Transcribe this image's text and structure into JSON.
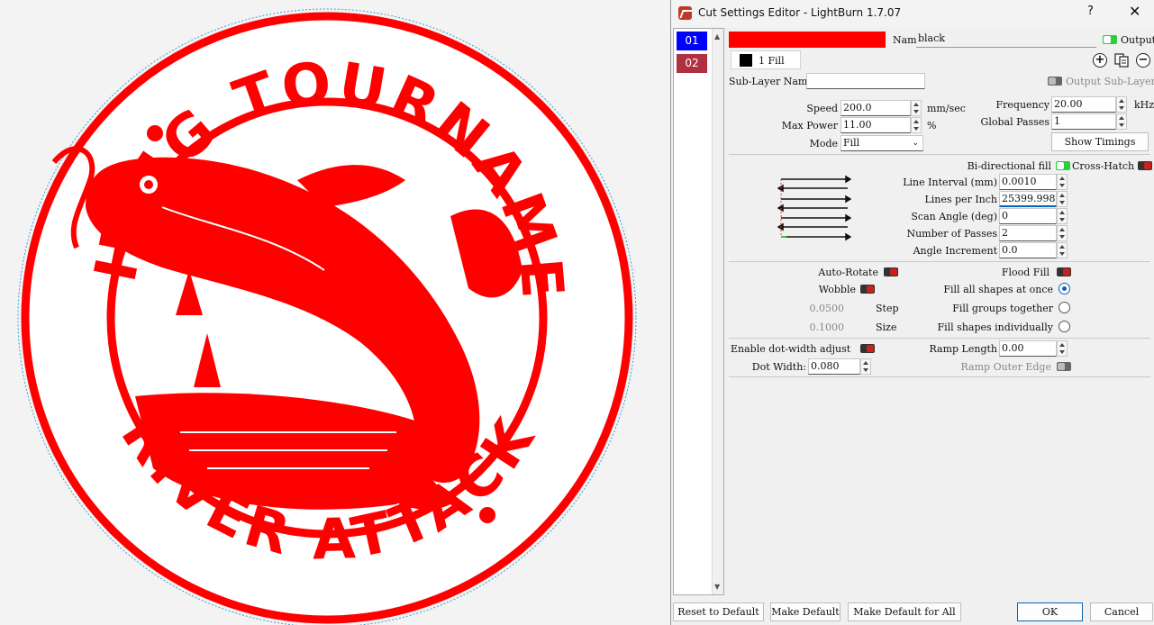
{
  "canvas": {
    "top_text": "FISHING TOURNAMENT",
    "bottom_text": "RIVER ATTACK",
    "design_color": "#ff0000"
  },
  "dialog": {
    "title": "Cut Settings Editor - LightBurn 1.7.07",
    "help": "?",
    "close": "✕",
    "layers": [
      {
        "label": "01",
        "color": "#0000ff"
      },
      {
        "label": "02",
        "color": "#b03040"
      }
    ],
    "layer_color": "#ff0000",
    "name_label": "Name",
    "name_value": "black",
    "output_label": "Output",
    "sublayer_tab": "1 Fill",
    "sublayer_name_label": "Sub-Layer Name",
    "sublayer_name_value": "",
    "output_sublayer_label": "Output Sub-Layer",
    "speed": {
      "label": "Speed",
      "value": "200.0",
      "unit": "mm/sec"
    },
    "max_power": {
      "label": "Max Power",
      "value": "11.00",
      "unit": "%"
    },
    "mode": {
      "label": "Mode",
      "value": "Fill"
    },
    "frequency": {
      "label": "Frequency",
      "value": "20.00",
      "unit": "kHz"
    },
    "global_passes": {
      "label": "Global Passes",
      "value": "1"
    },
    "show_timings": "Show Timings",
    "bidir_label": "Bi-directional fill",
    "crosshatch_label": "Cross-Hatch",
    "line_interval": {
      "label": "Line Interval (mm)",
      "value": "0.0010"
    },
    "lines_per_inch": {
      "label": "Lines per Inch",
      "value": "25399.998"
    },
    "scan_angle": {
      "label": "Scan Angle (deg)",
      "value": "0"
    },
    "num_passes": {
      "label": "Number of Passes",
      "value": "2"
    },
    "angle_increment": {
      "label": "Angle Increment",
      "value": "0.0"
    },
    "auto_rotate": "Auto-Rotate",
    "flood_fill": "Flood Fill",
    "wobble": "Wobble",
    "step": {
      "label": "Step",
      "value": "0.0500"
    },
    "size": {
      "label": "Size",
      "value": "0.1000"
    },
    "fill_all": "Fill all shapes at once",
    "fill_groups": "Fill groups together",
    "fill_individual": "Fill shapes individually",
    "dot_width_adjust": "Enable dot-width adjust",
    "dot_width": {
      "label": "Dot Width:",
      "value": "0.080"
    },
    "ramp_length": {
      "label": "Ramp Length",
      "value": "0.00"
    },
    "ramp_outer_edge": "Ramp Outer Edge",
    "buttons": {
      "reset": "Reset to Default",
      "make_default": "Make Default",
      "make_default_all": "Make Default for All",
      "ok": "OK",
      "cancel": "Cancel"
    }
  }
}
